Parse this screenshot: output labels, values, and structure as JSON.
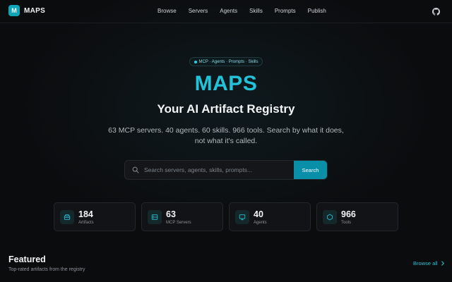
{
  "header": {
    "logo_letter": "M",
    "brand": "MAPS",
    "nav": [
      "Browse",
      "Servers",
      "Agents",
      "Skills",
      "Prompts",
      "Publish"
    ],
    "github_icon": "github-icon"
  },
  "hero": {
    "badge": "MCP · Agents · Prompts · Skills",
    "title": "MAPS",
    "subtitle": "Your AI Artifact Registry",
    "description": "63 MCP servers. 40 agents. 60 skills. 966 tools. Search by what it does, not what it's called."
  },
  "search": {
    "placeholder": "Search servers, agents, skills, prompts...",
    "value": "",
    "button_label": "Search"
  },
  "stats": [
    {
      "value": "184",
      "label": "Artifacts",
      "icon": "box-icon"
    },
    {
      "value": "63",
      "label": "MCP Servers",
      "icon": "server-icon"
    },
    {
      "value": "40",
      "label": "Agents",
      "icon": "monitor-icon"
    },
    {
      "value": "966",
      "label": "Tools",
      "icon": "hexagon-icon"
    }
  ],
  "featured": {
    "title": "Featured",
    "subtitle": "Top-rated artifacts from the registry",
    "browse_all": "Browse all"
  },
  "colors": {
    "accent": "#22c3d8",
    "button": "#0a8fa8",
    "background": "#0b0c0e"
  }
}
